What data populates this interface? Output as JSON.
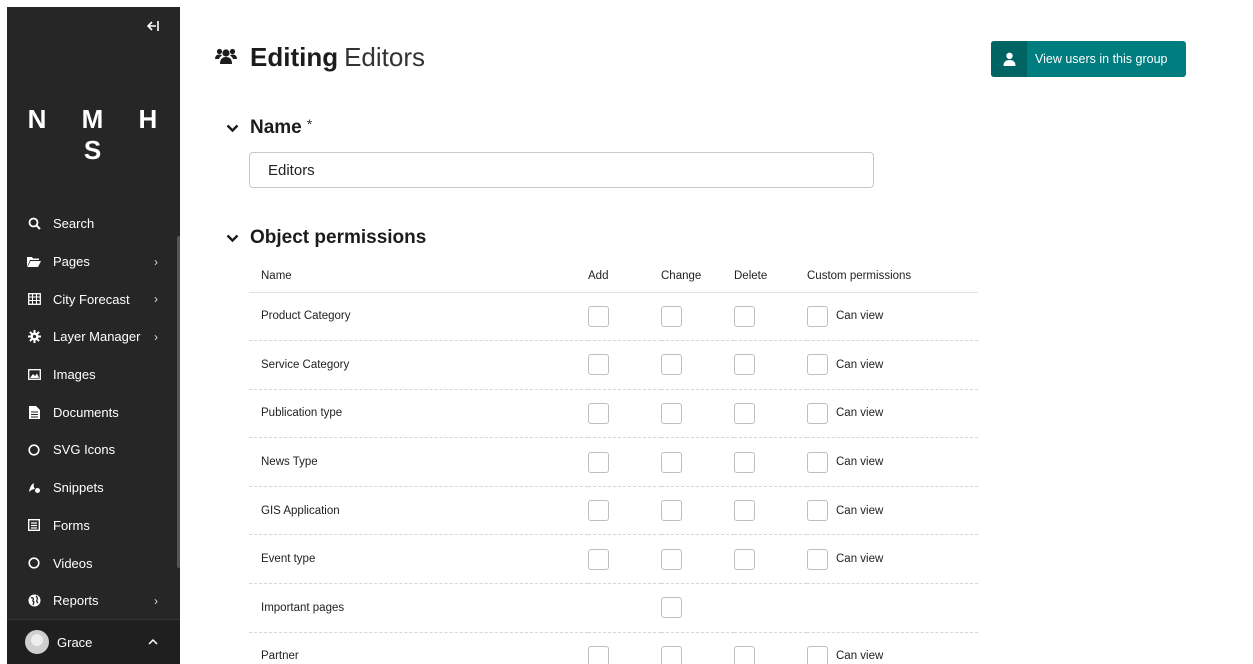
{
  "sidebar": {
    "logo": "N M H S",
    "collapse_icon": "collapse-left-icon",
    "items": [
      {
        "label": "Search",
        "icon": "search-icon",
        "has_submenu": false
      },
      {
        "label": "Pages",
        "icon": "folder-open-icon",
        "has_submenu": true
      },
      {
        "label": "City Forecast",
        "icon": "table-icon",
        "has_submenu": true
      },
      {
        "label": "Layer Manager",
        "icon": "cog-icon",
        "has_submenu": true
      },
      {
        "label": "Images",
        "icon": "image-icon",
        "has_submenu": false
      },
      {
        "label": "Documents",
        "icon": "document-icon",
        "has_submenu": false
      },
      {
        "label": "SVG Icons",
        "icon": "circle-icon",
        "has_submenu": false
      },
      {
        "label": "Snippets",
        "icon": "snippet-icon",
        "has_submenu": false
      },
      {
        "label": "Forms",
        "icon": "form-icon",
        "has_submenu": false
      },
      {
        "label": "Videos",
        "icon": "circle-icon",
        "has_submenu": false
      },
      {
        "label": "Reports",
        "icon": "globe-icon",
        "has_submenu": true
      }
    ],
    "user": {
      "name": "Grace"
    }
  },
  "header": {
    "title_bold": "Editing",
    "title_rest": "Editors",
    "icon": "group-icon",
    "users_button": "View users in this group"
  },
  "name_section": {
    "heading": "Name",
    "required_mark": "*",
    "value": "Editors"
  },
  "permissions_section": {
    "heading": "Object permissions",
    "columns": [
      "Name",
      "Add",
      "Change",
      "Delete",
      "Custom permissions"
    ],
    "rows": [
      {
        "name": "Product Category",
        "add": true,
        "change": true,
        "delete": true,
        "custom": "Can view"
      },
      {
        "name": "Service Category",
        "add": true,
        "change": true,
        "delete": true,
        "custom": "Can view"
      },
      {
        "name": "Publication type",
        "add": true,
        "change": true,
        "delete": true,
        "custom": "Can view"
      },
      {
        "name": "News Type",
        "add": true,
        "change": true,
        "delete": true,
        "custom": "Can view"
      },
      {
        "name": "GIS Application",
        "add": true,
        "change": true,
        "delete": true,
        "custom": "Can view"
      },
      {
        "name": "Event type",
        "add": true,
        "change": true,
        "delete": true,
        "custom": "Can view"
      },
      {
        "name": "Important pages",
        "add": false,
        "change": true,
        "delete": false,
        "custom": ""
      },
      {
        "name": "Partner",
        "add": true,
        "change": true,
        "delete": true,
        "custom": "Can view"
      }
    ]
  },
  "colors": {
    "sidebar_bg": "#262626",
    "accent": "#007d7e"
  }
}
